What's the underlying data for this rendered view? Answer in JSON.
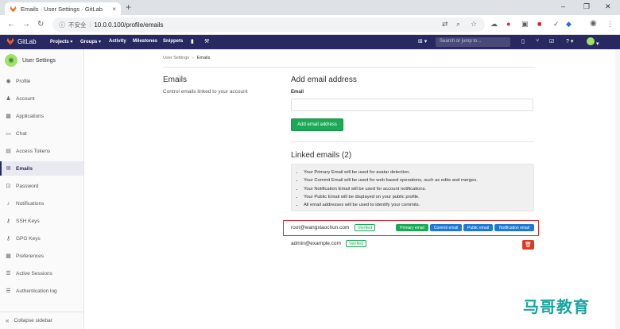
{
  "browser": {
    "tab_title": "Emails · User Settings · GitLab",
    "tab_close": "×",
    "new_tab": "+",
    "address_insecure": "不安全",
    "address_url": "10.0.0.100/profile/emails",
    "window_controls": [
      "–",
      "❐",
      "✕"
    ]
  },
  "gitlab_header": {
    "brand": "GitLab",
    "nav": [
      "Projects ▾",
      "Groups ▾",
      "Activity",
      "Milestones",
      "Snippets"
    ],
    "search_placeholder": "Search or jump to..."
  },
  "sidebar": {
    "title": "User Settings",
    "items": [
      {
        "label": "Profile",
        "icon": "user-icon"
      },
      {
        "label": "Account",
        "icon": "account-icon"
      },
      {
        "label": "Applications",
        "icon": "applications-icon"
      },
      {
        "label": "Chat",
        "icon": "chat-icon"
      },
      {
        "label": "Access Tokens",
        "icon": "token-icon"
      },
      {
        "label": "Emails",
        "icon": "mail-icon",
        "active": true
      },
      {
        "label": "Password",
        "icon": "lock-icon"
      },
      {
        "label": "Notifications",
        "icon": "bell-icon"
      },
      {
        "label": "SSH Keys",
        "icon": "key-icon"
      },
      {
        "label": "GPG Keys",
        "icon": "gpg-key-icon"
      },
      {
        "label": "Preferences",
        "icon": "preferences-icon"
      },
      {
        "label": "Active Sessions",
        "icon": "sessions-icon"
      },
      {
        "label": "Authentication log",
        "icon": "log-icon"
      }
    ],
    "collapse_label": "Collapse sidebar"
  },
  "breadcrumb": {
    "parent": "User Settings",
    "separator": "›",
    "current": "Emails"
  },
  "left_panel": {
    "title": "Emails",
    "description": "Control emails linked to your account"
  },
  "add_email": {
    "title": "Add email address",
    "field_label": "Email",
    "field_value": "",
    "button_label": "Add email address"
  },
  "linked_emails": {
    "title": "Linked emails (2)",
    "info": [
      "Your Primary Email will be used for avatar detection.",
      "Your Commit Email will be used for web based operations, such as edits and merges.",
      "Your Notification Email will be used for account notifications.",
      "Your Public Email will be displayed on your public profile.",
      "All email addresses will be used to identify your commits."
    ],
    "emails": [
      {
        "address": "root@wangxiaochun.com",
        "verified": "Verified",
        "badges": [
          "Primary email",
          "Commit email",
          "Public email",
          "Notification email"
        ]
      },
      {
        "address": "admin@example.com",
        "verified": "Verified"
      }
    ]
  },
  "watermark": "马哥教育",
  "colors": {
    "header": "#292961",
    "green": "#1aaa55",
    "blue_badge": "#1f78d1",
    "danger": "#db3b21",
    "highlight": "#e0292c"
  }
}
